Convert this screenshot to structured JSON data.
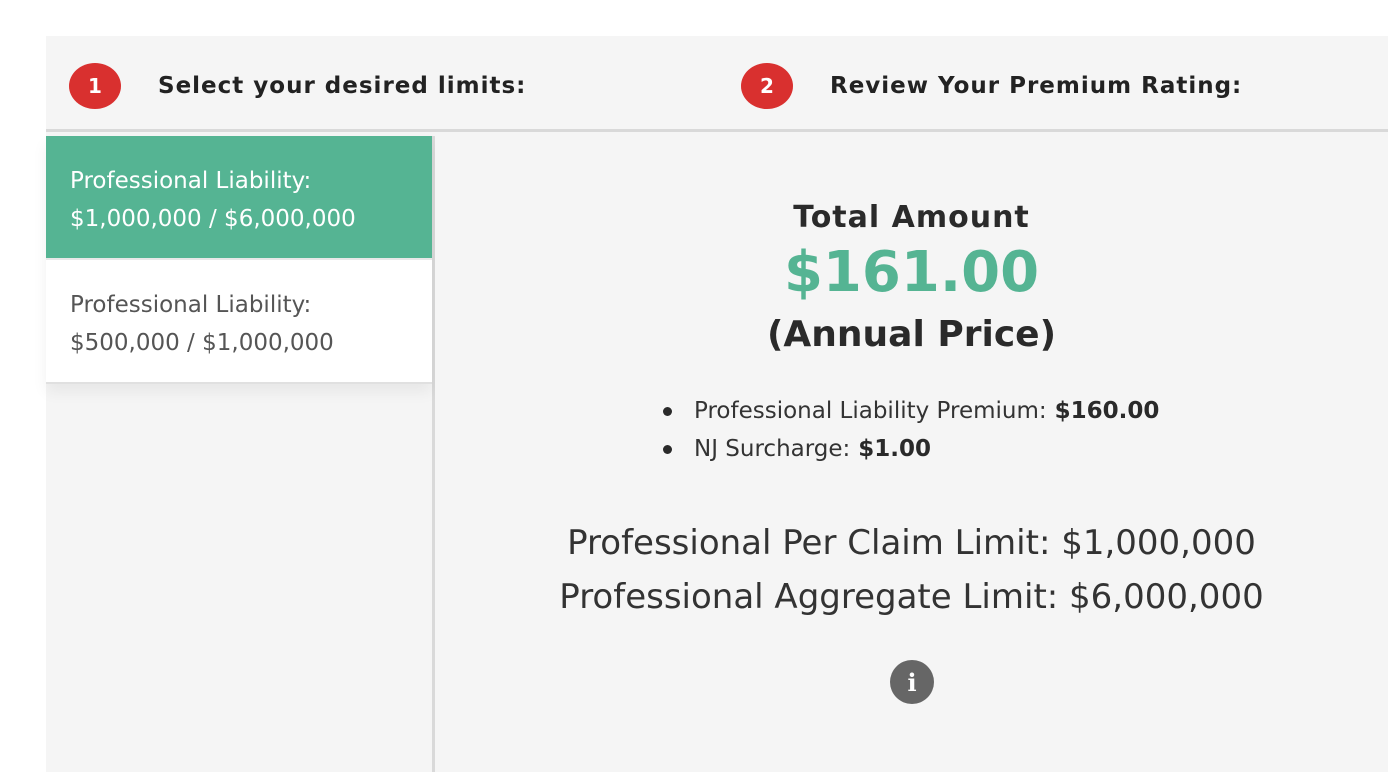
{
  "steps": [
    {
      "number": "1",
      "label": "Select your desired limits:"
    },
    {
      "number": "2",
      "label": "Review Your Premium Rating:"
    }
  ],
  "limit_options": [
    {
      "line1": "Professional Liability:",
      "line2": "$1,000,000 / $6,000,000",
      "selected": true
    },
    {
      "line1": "Professional Liability:",
      "line2": "$500,000 / $1,000,000",
      "selected": false
    }
  ],
  "summary": {
    "title": "Total Amount",
    "amount": "$161.00",
    "period": "(Annual Price)",
    "breakdown": [
      {
        "label": "Professional Liability Premium:",
        "value": "$160.00"
      },
      {
        "label": "NJ Surcharge:",
        "value": "$1.00"
      }
    ],
    "per_claim_limit": "Professional Per Claim Limit: $1,000,000",
    "aggregate_limit": "Professional Aggregate Limit: $6,000,000",
    "info_icon": "info-icon"
  },
  "colors": {
    "accent_green": "#55b493",
    "step_badge_red": "#d9302f",
    "panel_background": "#f5f5f5",
    "info_icon_gray": "#666666"
  }
}
